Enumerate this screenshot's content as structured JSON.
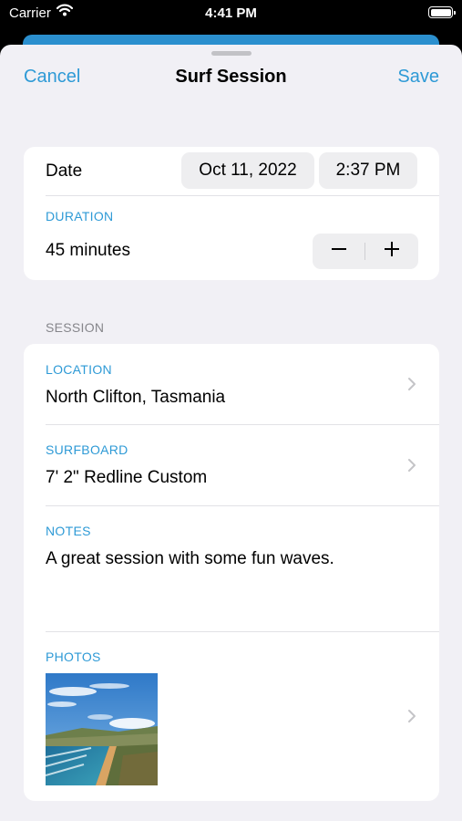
{
  "status_bar": {
    "carrier": "Carrier",
    "time": "4:41 PM"
  },
  "nav": {
    "cancel_label": "Cancel",
    "title": "Surf Session",
    "save_label": "Save"
  },
  "datetime": {
    "label": "Date",
    "date": "Oct 11, 2022",
    "time": "2:37 PM"
  },
  "duration": {
    "caption": "DURATION",
    "value": "45 minutes",
    "decrement": "−",
    "increment": "+"
  },
  "session": {
    "header": "SESSION",
    "location": {
      "caption": "LOCATION",
      "value": "North Clifton, Tasmania"
    },
    "surfboard": {
      "caption": "SURFBOARD",
      "value": "7' 2\" Redline Custom"
    },
    "notes": {
      "caption": "NOTES",
      "value": "A great session with some fun waves."
    },
    "photos": {
      "caption": "PHOTOS"
    }
  },
  "colors": {
    "accent": "#2e9ad6",
    "background": "#f1f0f5",
    "card": "#ffffff",
    "header_strip": "#2b8fce"
  },
  "icons": [
    "wifi-icon",
    "battery-icon",
    "chevron-right-icon",
    "minus-icon",
    "plus-icon"
  ]
}
